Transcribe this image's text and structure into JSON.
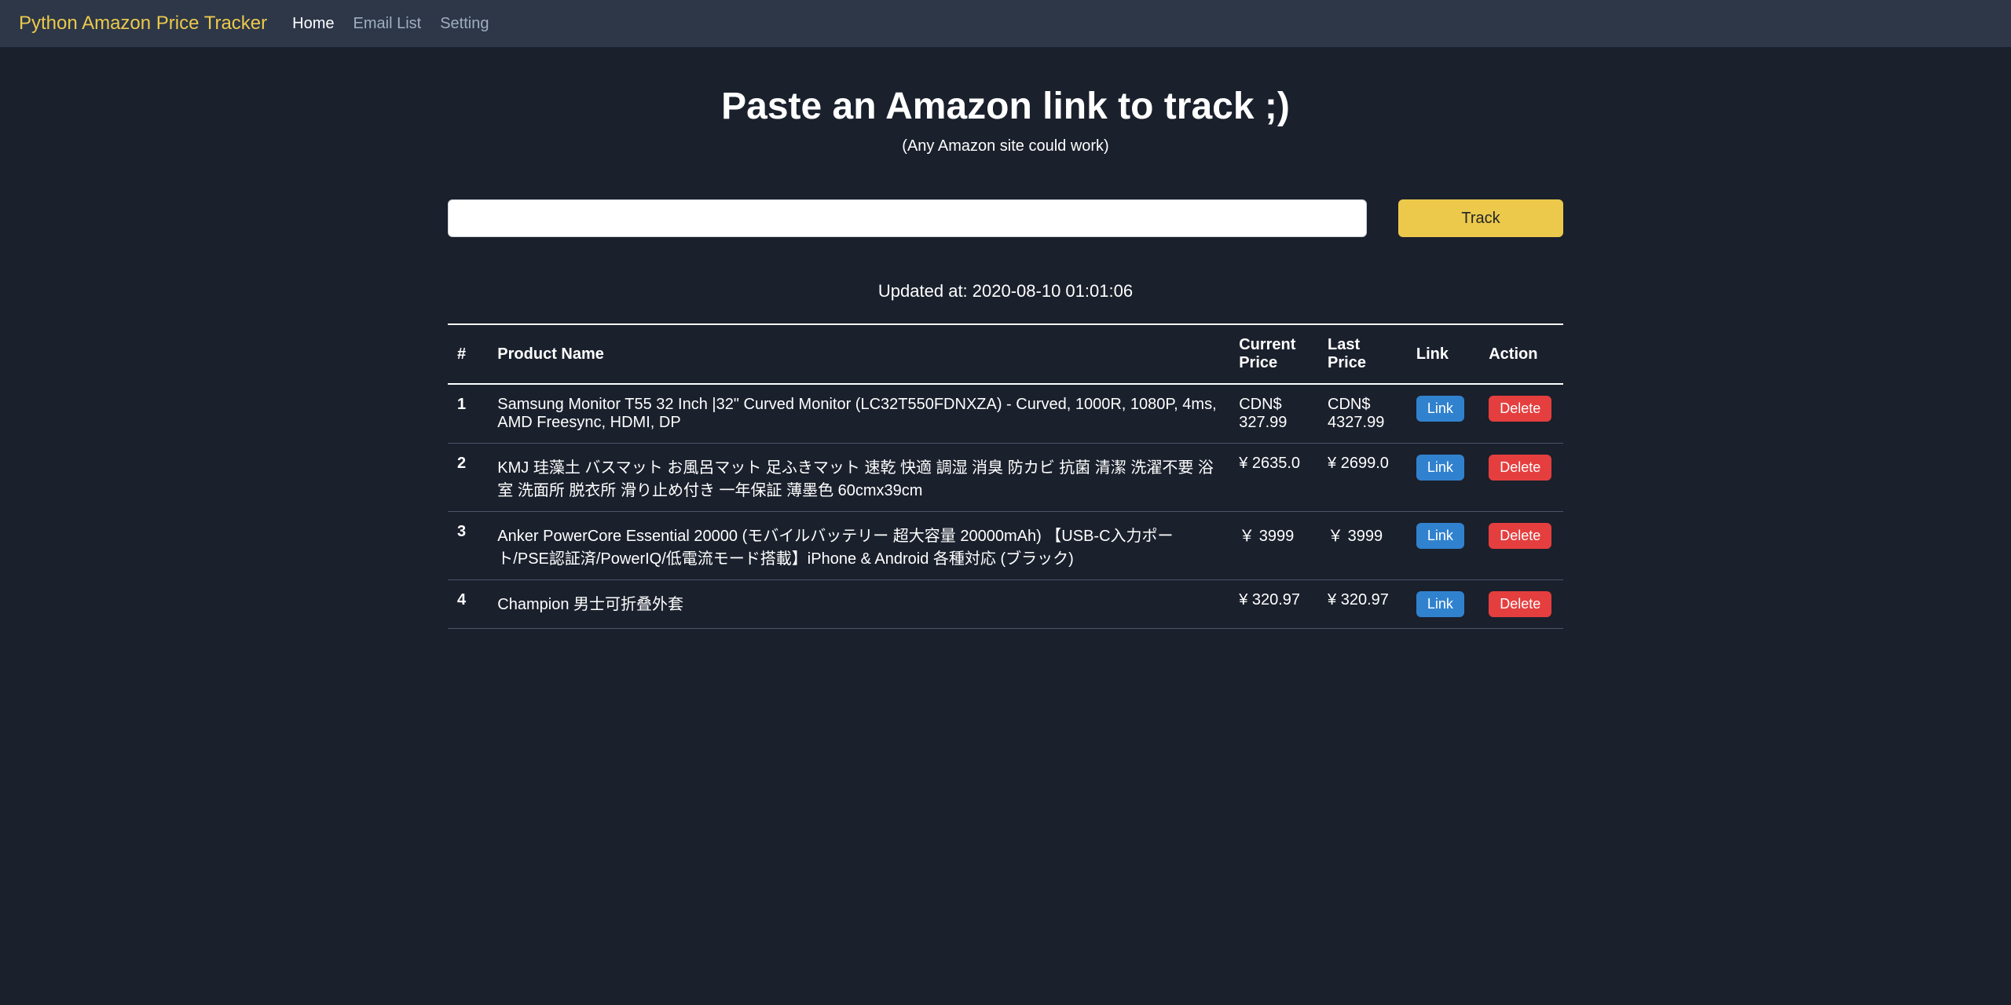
{
  "navbar": {
    "brand": "Python Amazon Price Tracker",
    "links": [
      {
        "label": "Home",
        "active": true
      },
      {
        "label": "Email List",
        "active": false
      },
      {
        "label": "Setting",
        "active": false
      }
    ]
  },
  "hero": {
    "title": "Paste an Amazon link to track ;)",
    "subtitle": "(Any Amazon site could work)"
  },
  "form": {
    "input_value": "",
    "button_label": "Track"
  },
  "updated_label": "Updated at: 2020-08-10 01:01:06",
  "table": {
    "headers": {
      "num": "#",
      "name": "Product Name",
      "current": "Current Price",
      "last": "Last Price",
      "link": "Link",
      "action": "Action"
    },
    "rows": [
      {
        "num": "1",
        "name": "Samsung Monitor T55 32 Inch |32\" Curved Monitor (LC32T550FDNXZA) - Curved, 1000R, 1080P, 4ms, AMD Freesync, HDMI, DP",
        "current": "CDN$ 327.99",
        "last": "CDN$ 4327.99",
        "link_label": "Link",
        "delete_label": "Delete"
      },
      {
        "num": "2",
        "name": "KMJ 珪藻土 バスマット お風呂マット 足ふきマット 速乾 快適 調湿 消臭 防カビ 抗菌 清潔 洗濯不要 浴室 洗面所 脱衣所 滑り止め付き 一年保証 薄墨色 60cmx39cm",
        "current": "¥ 2635.0",
        "last": "¥ 2699.0",
        "link_label": "Link",
        "delete_label": "Delete"
      },
      {
        "num": "3",
        "name": "Anker PowerCore Essential 20000 (モバイルバッテリー 超大容量 20000mAh) 【USB-C入力ポート/PSE認証済/PowerIQ/低電流モード搭載】iPhone & Android 各種対応 (ブラック)",
        "current": "￥ 3999",
        "last": "￥ 3999",
        "link_label": "Link",
        "delete_label": "Delete"
      },
      {
        "num": "4",
        "name": "Champion 男士可折叠外套",
        "current": "¥ 320.97",
        "last": "¥ 320.97",
        "link_label": "Link",
        "delete_label": "Delete"
      }
    ]
  }
}
